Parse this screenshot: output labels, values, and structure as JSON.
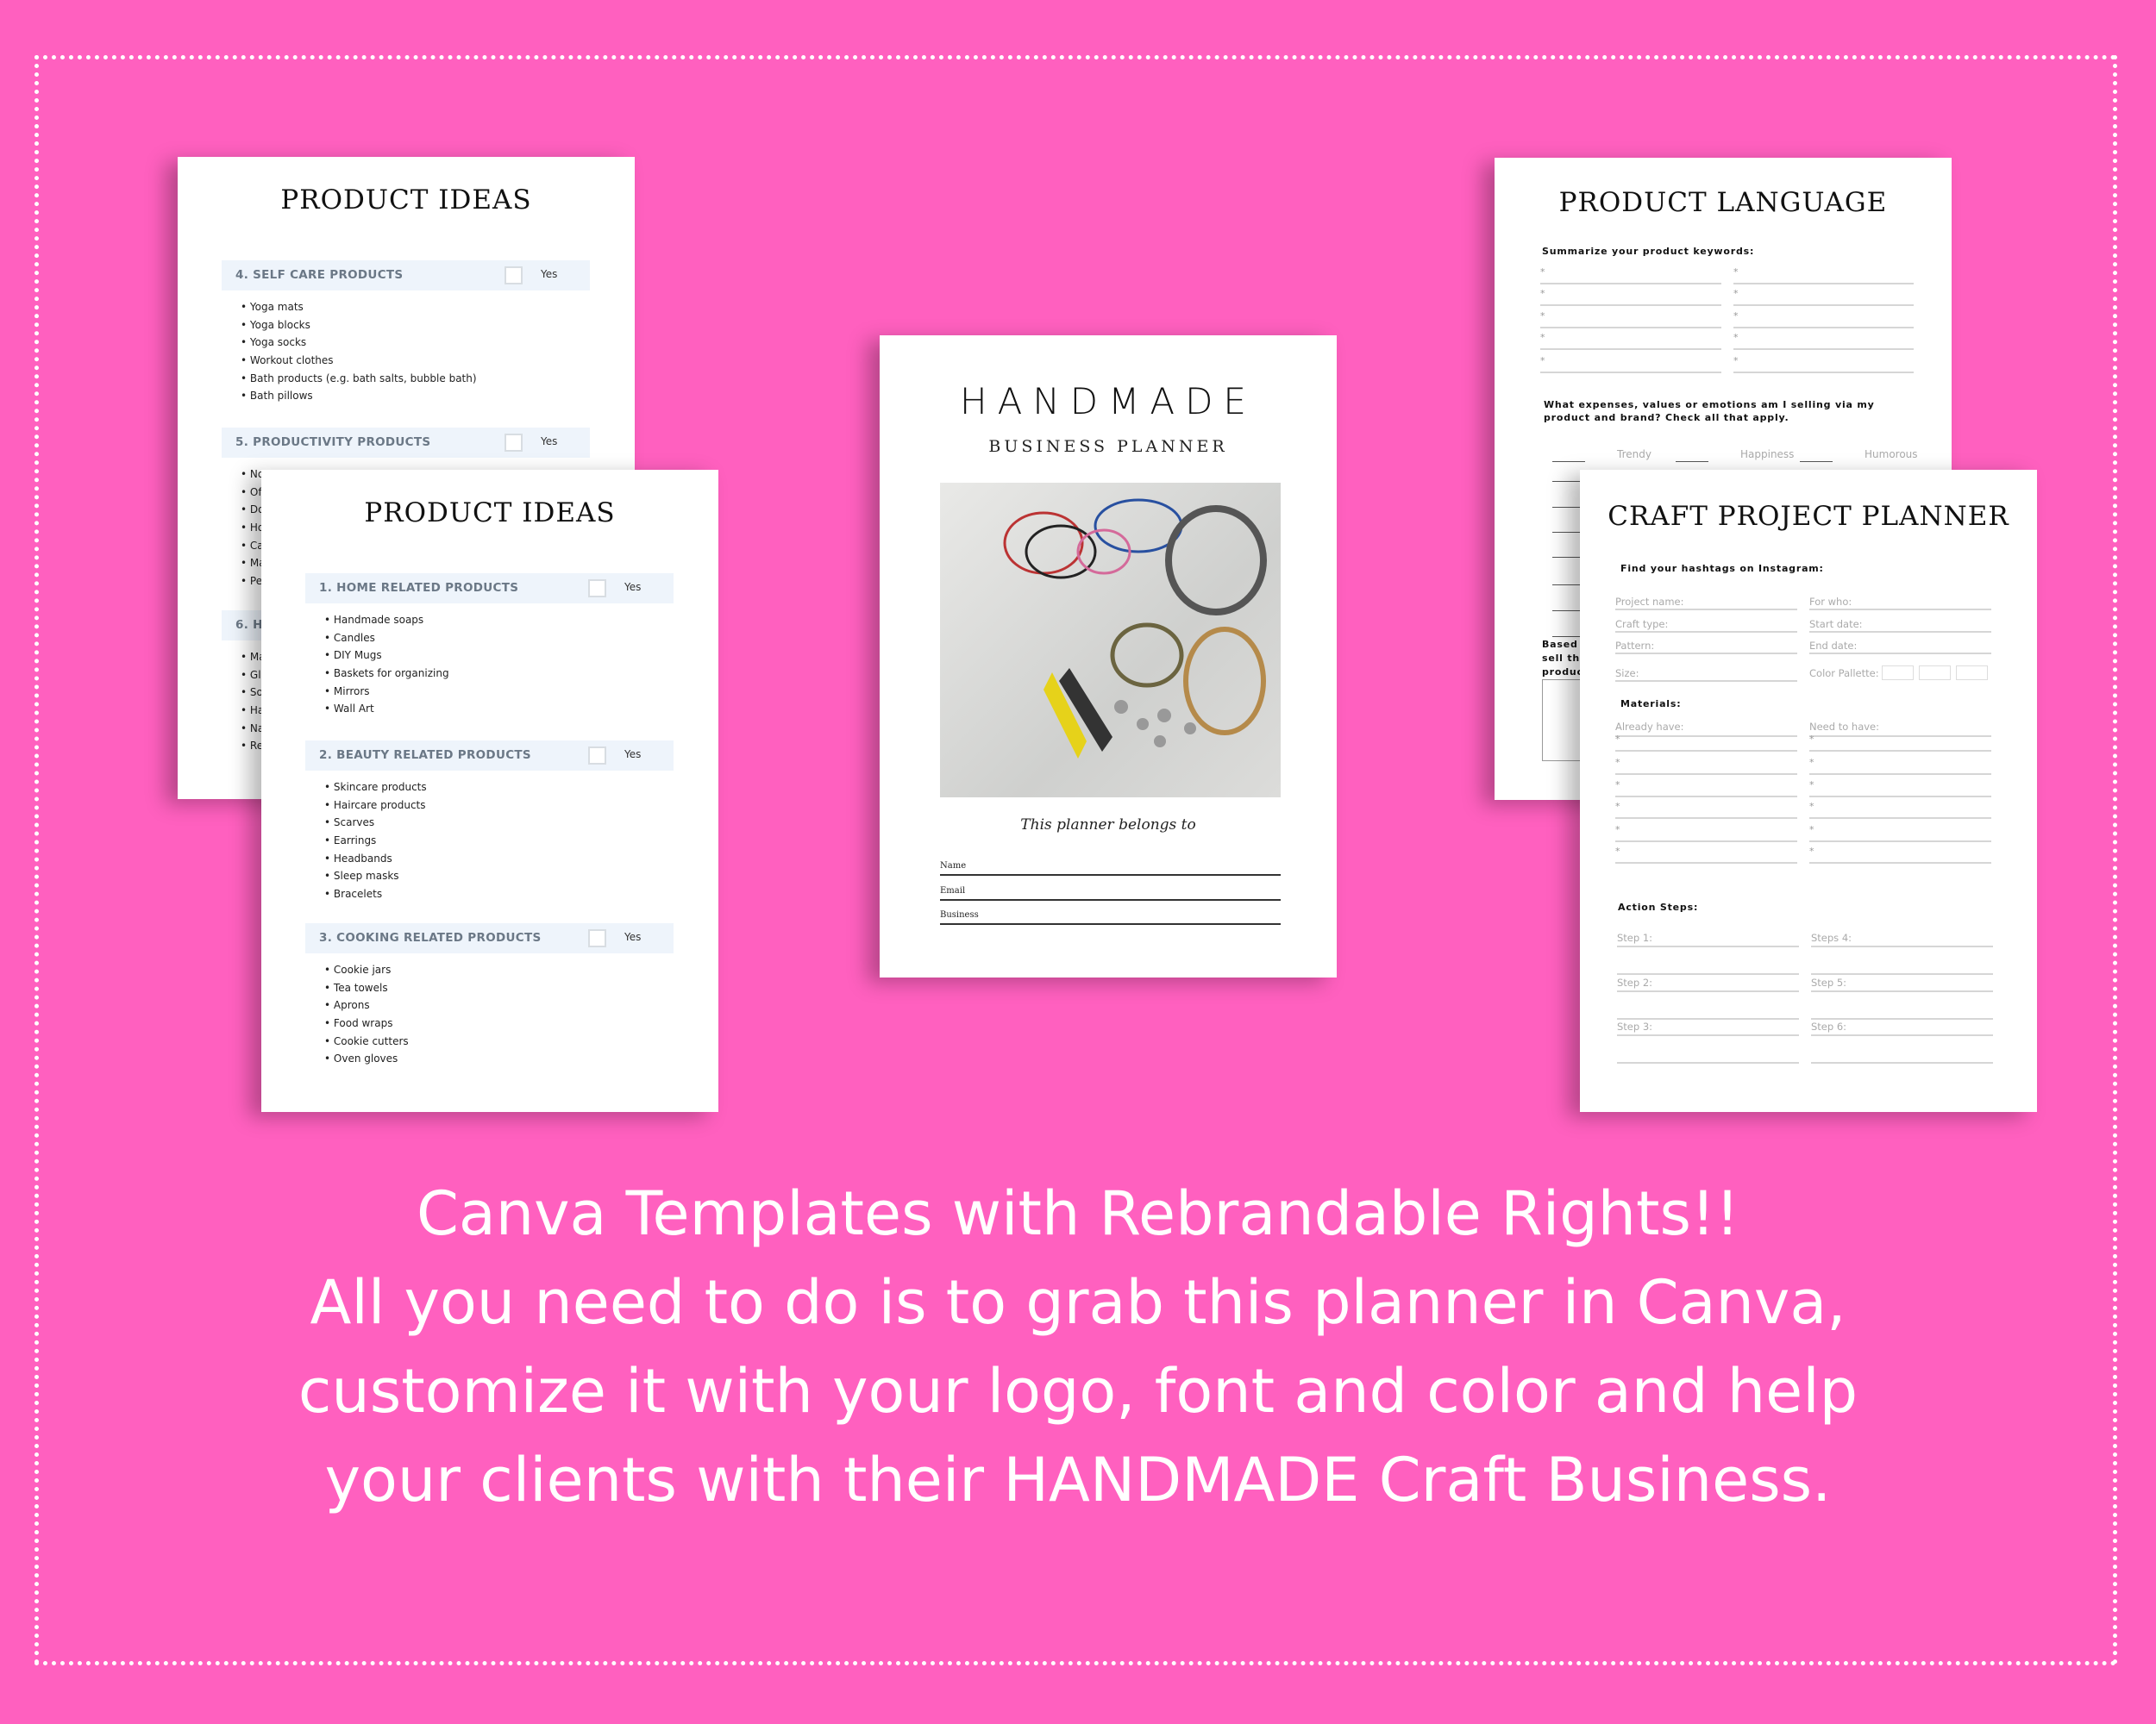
{
  "colors": {
    "background": "#ff60bf",
    "page": "#ffffff",
    "section_bar": "#eef4fb"
  },
  "back_left": {
    "title": "PRODUCT IDEAS",
    "sections": [
      {
        "title": "4. SELF CARE PRODUCTS",
        "yes": "Yes",
        "items": [
          "Yoga mats",
          "Yoga blocks",
          "Yoga socks",
          "Workout clothes",
          "Bath products (e.g. bath salts, bubble bath)",
          "Bath pillows"
        ]
      },
      {
        "title": "5. PRODUCTIVITY PRODUCTS",
        "yes": "Yes",
        "items": [
          "No",
          "Of",
          "Do",
          "Ho",
          "Ca",
          "Ma",
          "Pe"
        ]
      },
      {
        "title": "6. HE",
        "yes": "",
        "items": [
          "Ma",
          "Gl",
          "So",
          "Ha",
          "Na",
          "Re"
        ]
      }
    ]
  },
  "front_left": {
    "title": "PRODUCT IDEAS",
    "sections": [
      {
        "title": "1. HOME RELATED PRODUCTS",
        "yes": "Yes",
        "items": [
          "Handmade soaps",
          "Candles",
          "DIY Mugs",
          "Baskets for organizing",
          "Mirrors",
          "Wall Art"
        ]
      },
      {
        "title": "2. BEAUTY RELATED PRODUCTS",
        "yes": "Yes",
        "items": [
          "Skincare products",
          "Haircare products",
          "Scarves",
          "Earrings",
          "Headbands",
          "Sleep masks",
          "Bracelets"
        ]
      },
      {
        "title": "3. COOKING RELATED PRODUCTS",
        "yes": "Yes",
        "items": [
          "Cookie jars",
          "Tea towels",
          "Aprons",
          "Food wraps",
          "Cookie cutters",
          "Oven gloves"
        ]
      }
    ]
  },
  "cover": {
    "title": "HANDMADE",
    "subtitle": "BUSINESS PLANNER",
    "belongs": "This planner belongs to",
    "fields": [
      "Name",
      "Email",
      "Business"
    ]
  },
  "language": {
    "title": "PRODUCT LANGUAGE",
    "keywords_label": "Summarize your product keywords:",
    "star": "*",
    "question": "What expenses, values or emotions am I selling via my product and brand? Check all that apply.",
    "options": [
      "Trendy",
      "Happiness",
      "Humorous"
    ],
    "based": [
      "Based o",
      "sell the",
      "produc"
    ]
  },
  "craft": {
    "title": "CRAFT PROJECT PLANNER",
    "hashtags": "Find your hashtags on Instagram:",
    "fields_left": [
      "Project name:",
      "Craft type:",
      "Pattern:",
      "Size:"
    ],
    "fields_right": [
      "For who:",
      "Start date:",
      "End date:",
      "Color Pallette:"
    ],
    "materials": "Materials:",
    "already": "Already have:",
    "need": "Need to have:",
    "star": "*",
    "action": "Action Steps:",
    "steps_left": [
      "Step 1:",
      "Step 2:",
      "Step 3:"
    ],
    "steps_right": [
      "Steps 4:",
      "Step 5:",
      "Step 6:"
    ]
  },
  "caption": [
    "Canva Templates with Rebrandable Rights!!",
    "All you need to do is to grab this planner in Canva,",
    "customize it with your logo, font and color and help",
    "your clients with their HANDMADE Craft Business."
  ]
}
